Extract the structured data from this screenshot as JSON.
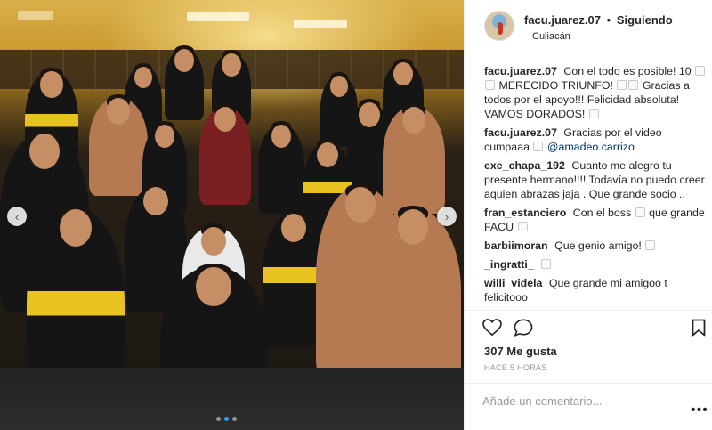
{
  "post": {
    "username": "facu.juarez.07",
    "separator": "•",
    "follow_status": "Siguiendo",
    "location": "Culiacán"
  },
  "comments": [
    {
      "user": "facu.juarez.07",
      "parts": [
        "Con el todo es posible! 10",
        "MERECIDO TRIUNFO!",
        "Gracias a todos por el apoyo!!! Felicidad absoluta! VAMOS DORADOS!"
      ]
    },
    {
      "user": "facu.juarez.07",
      "text": "Gracias por el video cumpaaa",
      "mention": "@amadeo.carrizo"
    },
    {
      "user": "exe_chapa_192",
      "text": "Cuanto me alegro tu presente hermano!!!! Todavía no puedo creer aquien abrazas jaja . Que grande socio .."
    },
    {
      "user": "fran_estanciero",
      "text_a": "Con el boss",
      "text_b": "que grande FACU"
    },
    {
      "user": "barbiimoran",
      "text": "Que genio amigo!"
    },
    {
      "user": "_ingratti_",
      "text": ""
    },
    {
      "user": "willi_videla",
      "text": "Que grande mi amigoo t felicitooo"
    }
  ],
  "actions": {
    "like_icon": "heart-icon",
    "comment_icon": "comment-icon",
    "save_icon": "bookmark-icon"
  },
  "likes": "307 Me gusta",
  "time_ago": "HACE 5 HORAS",
  "add_comment_placeholder": "Añade un comentario...",
  "more_label": "•••",
  "carousel": {
    "prev_icon": "chevron-left-icon",
    "next_icon": "chevron-right-icon",
    "prev_glyph": "‹",
    "next_glyph": "›",
    "total_slides": 3,
    "active_slide": 2
  },
  "colors": {
    "accent_blue": "#3897f0",
    "mention": "#003569",
    "team_yellow": "#e8c21e"
  }
}
